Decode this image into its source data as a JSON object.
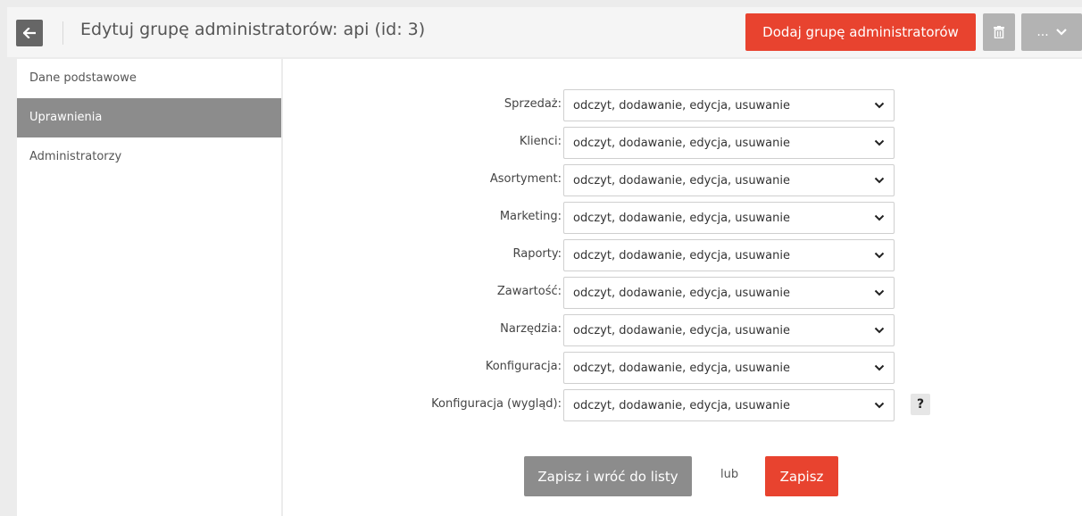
{
  "header": {
    "title": "Edytuj grupę administratorów: api (id: 3)",
    "add_button": "Dodaj grupę administratorów",
    "more_button": "..."
  },
  "sidebar": {
    "items": [
      {
        "label": "Dane podstawowe",
        "active": false
      },
      {
        "label": "Uprawnienia",
        "active": true
      },
      {
        "label": "Administratorzy",
        "active": false
      }
    ]
  },
  "permissions": [
    {
      "label": "Sprzedaż:",
      "value": "odczyt, dodawanie, edycja, usuwanie"
    },
    {
      "label": "Klienci:",
      "value": "odczyt, dodawanie, edycja, usuwanie"
    },
    {
      "label": "Asortyment:",
      "value": "odczyt, dodawanie, edycja, usuwanie"
    },
    {
      "label": "Marketing:",
      "value": "odczyt, dodawanie, edycja, usuwanie"
    },
    {
      "label": "Raporty:",
      "value": "odczyt, dodawanie, edycja, usuwanie"
    },
    {
      "label": "Zawartość:",
      "value": "odczyt, dodawanie, edycja, usuwanie"
    },
    {
      "label": "Narzędzia:",
      "value": "odczyt, dodawanie, edycja, usuwanie"
    },
    {
      "label": "Konfiguracja:",
      "value": "odczyt, dodawanie, edycja, usuwanie"
    },
    {
      "label": "Konfiguracja (wygląd):",
      "value": "odczyt, dodawanie, edycja, usuwanie",
      "help": "?"
    }
  ],
  "actions": {
    "save_back": "Zapisz i wróć do listy",
    "or": "lub",
    "save": "Zapisz"
  },
  "icons": {
    "back": "arrow-left-icon",
    "trash": "trash-icon",
    "chevron": "chevron-down-icon"
  },
  "colors": {
    "accent": "#e8432f",
    "gray_button": "#8c8c8c",
    "light_gray_button": "#b3b3b3",
    "back_button": "#666666"
  }
}
